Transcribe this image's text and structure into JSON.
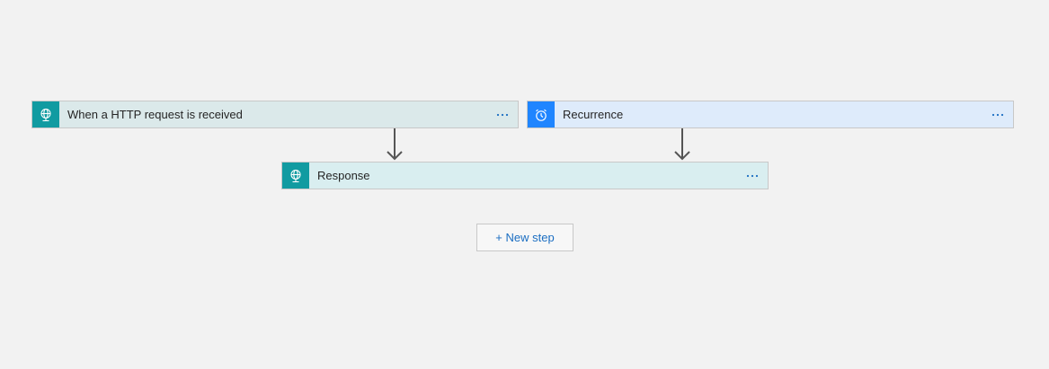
{
  "flow": {
    "triggers": [
      {
        "title": "When a HTTP request is received",
        "icon": "http-globe-icon",
        "accent": "#119ba1"
      },
      {
        "title": "Recurrence",
        "icon": "alarm-clock-icon",
        "accent": "#1f85ff"
      }
    ],
    "actions": [
      {
        "title": "Response",
        "icon": "http-globe-icon",
        "accent": "#119ba1"
      }
    ],
    "new_step_label": "+ New step"
  },
  "colors": {
    "background": "#f2f2f2",
    "http_card_bg": "#dbe9ea",
    "recurrence_card_bg": "#deebfb",
    "response_card_bg": "#d9eef0",
    "link": "#1b6ec2"
  }
}
